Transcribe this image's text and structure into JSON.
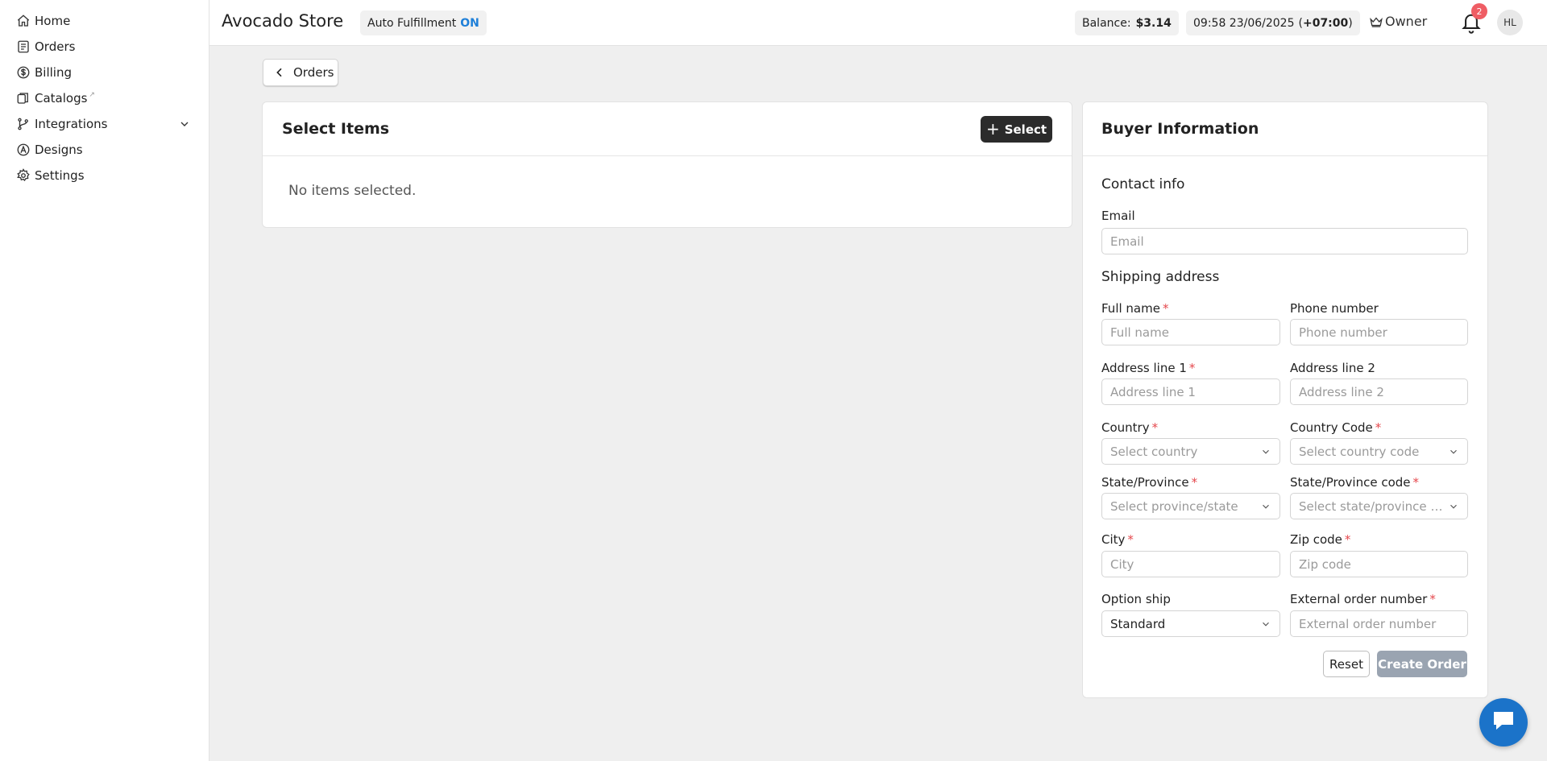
{
  "sidebar": {
    "items": [
      {
        "label": "Home",
        "icon": "home-icon"
      },
      {
        "label": "Orders",
        "icon": "orders-icon"
      },
      {
        "label": "Billing",
        "icon": "dollar-icon"
      },
      {
        "label": "Catalogs",
        "icon": "catalog-icon"
      },
      {
        "label": "Integrations",
        "icon": "branch-icon"
      },
      {
        "label": "Designs",
        "icon": "designs-icon"
      },
      {
        "label": "Settings",
        "icon": "gear-icon"
      }
    ]
  },
  "header": {
    "store_name": "Avocado Store",
    "auto_fulfillment_label": "Auto Fulfillment",
    "auto_fulfillment_state": "ON",
    "balance_label": "Balance:",
    "balance_value": "$3.14",
    "datetime": "09:58 23/06/2025",
    "timezone": "+07:00",
    "role": "Owner",
    "notification_count": "2",
    "avatar_initials": "HL"
  },
  "back_button": {
    "label": "Orders"
  },
  "select_items": {
    "title": "Select Items",
    "select_button": "Select",
    "empty_text": "No items selected."
  },
  "buyer": {
    "title": "Buyer Information",
    "contact_title": "Contact info",
    "email_label": "Email",
    "email_placeholder": "Email",
    "shipping_title": "Shipping address",
    "full_name_label": "Full name",
    "full_name_placeholder": "Full name",
    "phone_label": "Phone number",
    "phone_placeholder": "Phone number",
    "address1_label": "Address line 1",
    "address1_placeholder": "Address line 1",
    "address2_label": "Address line 2",
    "address2_placeholder": "Address line 2",
    "country_label": "Country",
    "country_placeholder": "Select country",
    "country_code_label": "Country Code",
    "country_code_placeholder": "Select country code",
    "state_label": "State/Province",
    "state_placeholder": "Select province/state",
    "state_code_label": "State/Province code",
    "state_code_placeholder": "Select state/province c...",
    "city_label": "City",
    "city_placeholder": "City",
    "zip_label": "Zip code",
    "zip_placeholder": "Zip code",
    "ship_label": "Option ship",
    "ship_value": "Standard",
    "external_label": "External order number",
    "external_placeholder": "External order number",
    "reset_button": "Reset",
    "create_button": "Create Order"
  },
  "colors": {
    "accent_on": "#1e7fd8",
    "required": "#e5484d",
    "primary_dark": "#2b2b2b",
    "disabled_button": "#9aa4b1",
    "chat_fab": "#1b73c9",
    "badge": "#ef5d64"
  }
}
